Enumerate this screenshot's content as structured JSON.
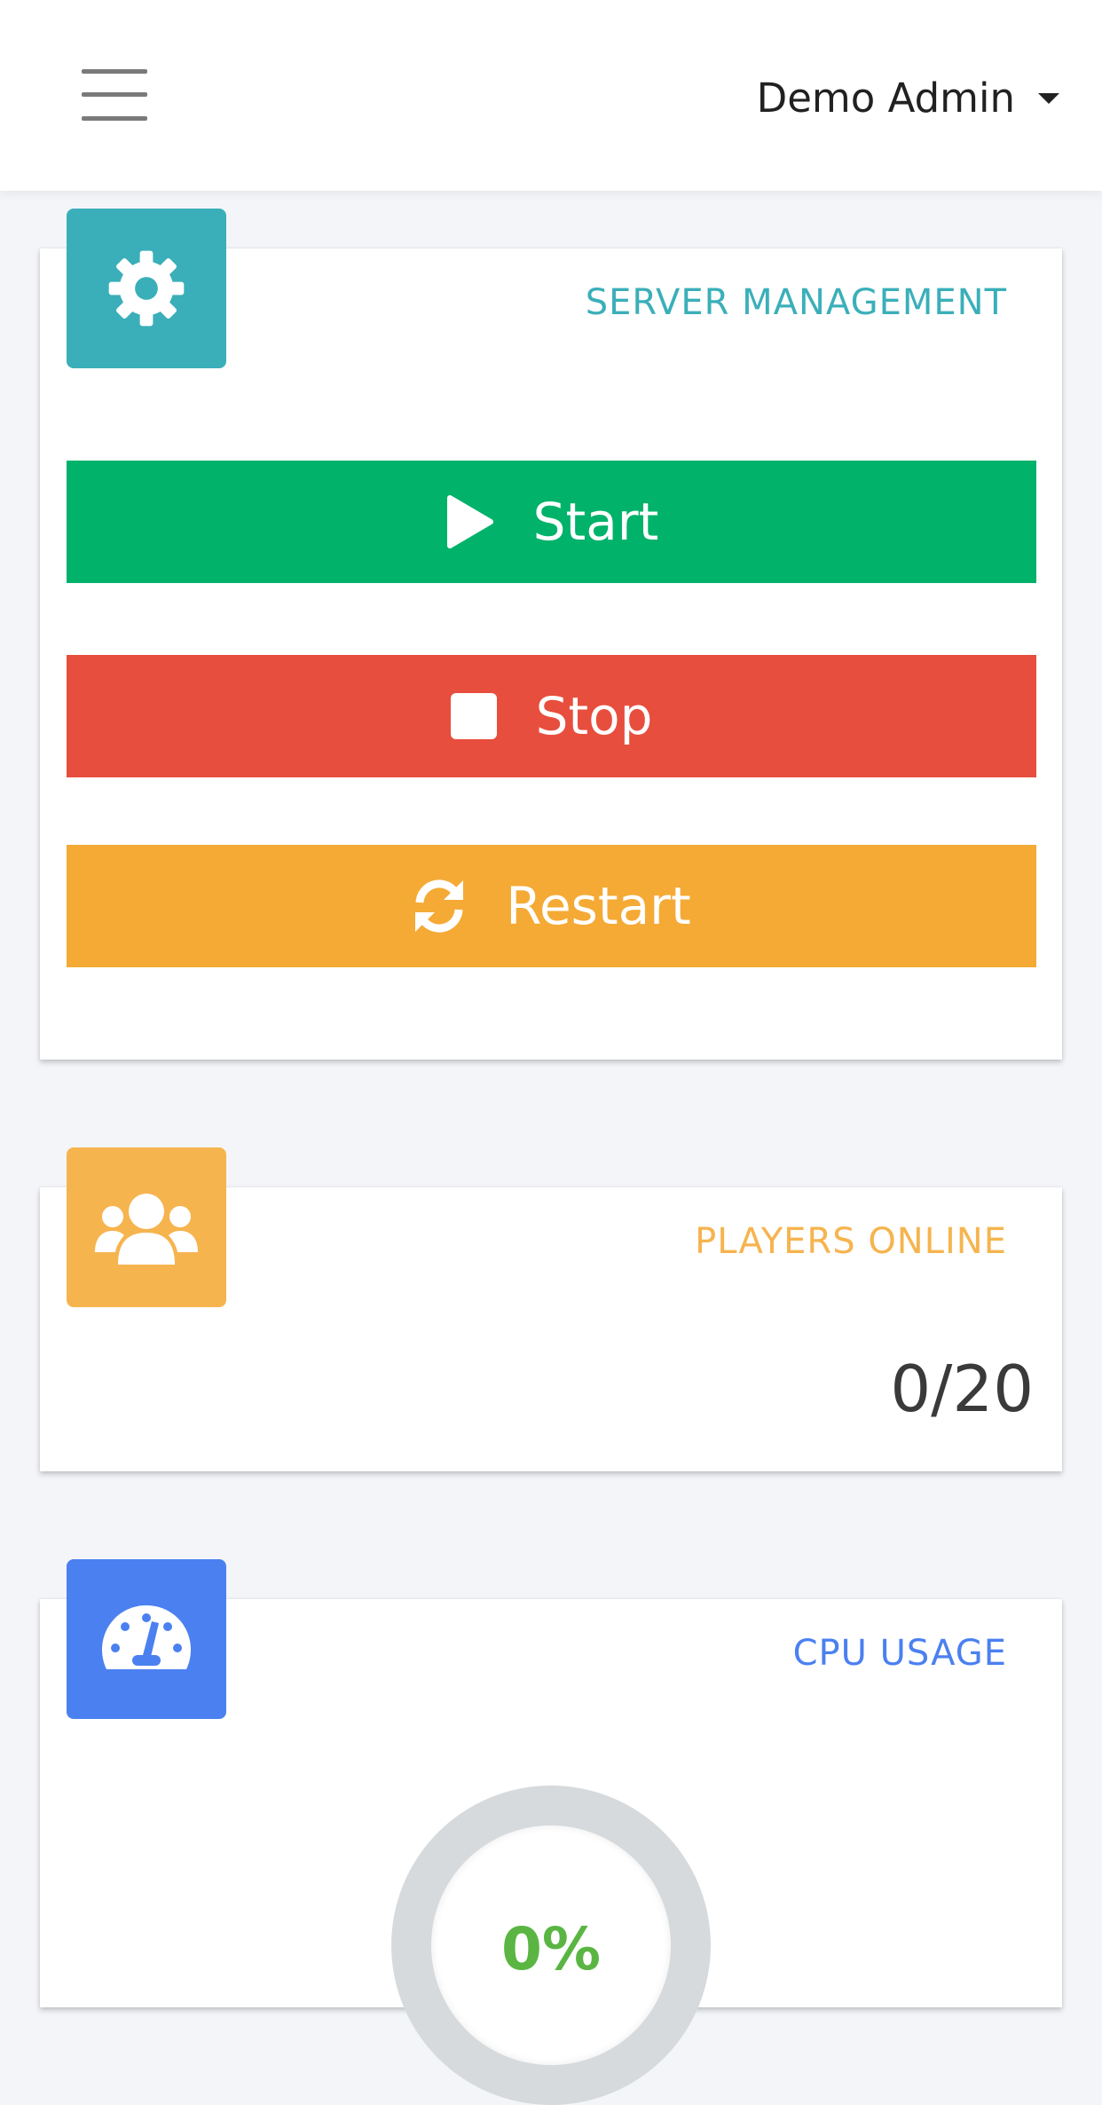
{
  "header": {
    "user_name": "Demo Admin"
  },
  "server_management": {
    "title": "SERVER MANAGEMENT",
    "icon": "gear-icon",
    "accent": "#3aafb9",
    "buttons": [
      {
        "label": "Start",
        "icon": "play-icon",
        "color": "#00b26a"
      },
      {
        "label": "Stop",
        "icon": "stop-icon",
        "color": "#e74e3d"
      },
      {
        "label": "Restart",
        "icon": "refresh-icon",
        "color": "#f4aa35"
      }
    ]
  },
  "players_online": {
    "title": "PLAYERS ONLINE",
    "icon": "users-icon",
    "accent": "#f6b44f",
    "value": "0/20"
  },
  "cpu_usage": {
    "title": "CPU USAGE",
    "icon": "speedometer-icon",
    "accent": "#4b80f0",
    "value": "0%",
    "value_color": "#5ab543"
  }
}
